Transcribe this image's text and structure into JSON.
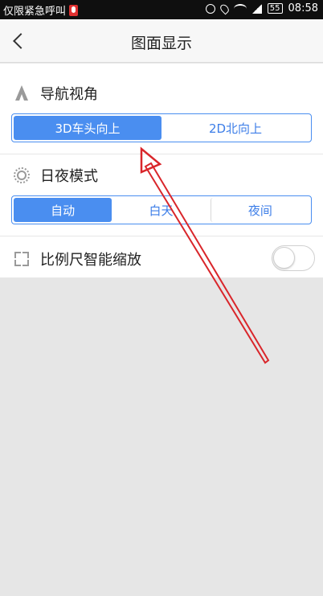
{
  "status_bar": {
    "left_text": "仅限紧急呼叫",
    "battery": "55",
    "time": "08:58"
  },
  "header": {
    "title": "图面显示"
  },
  "nav_view": {
    "label": "导航视角",
    "options": [
      "3D车头向上",
      "2D北向上"
    ],
    "selected": "3D车头向上"
  },
  "day_night": {
    "label": "日夜模式",
    "options": [
      "自动",
      "白天",
      "夜间"
    ],
    "selected": "自动"
  },
  "scale_smart_zoom": {
    "label": "比例尺智能缩放",
    "enabled": false
  },
  "colors": {
    "accent": "#4a8ef0",
    "annotation_arrow": "#d9262b"
  },
  "icons": [
    "back-chevron-icon",
    "navigation-arrow-icon",
    "sun-icon",
    "expand-icon",
    "mic-icon",
    "wifi-icon",
    "location-icon",
    "battery-icon"
  ]
}
